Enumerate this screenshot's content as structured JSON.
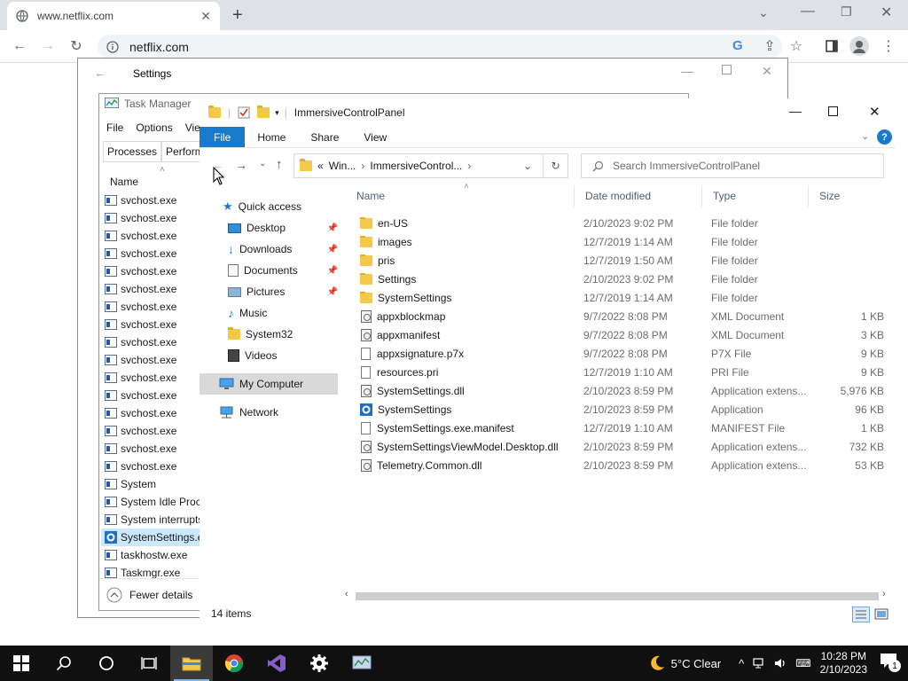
{
  "browser": {
    "tab_title": "www.netflix.com",
    "new_tab": "+",
    "url": "netflix.com"
  },
  "settings": {
    "title": "Settings"
  },
  "taskmgr": {
    "title": "Task Manager",
    "menu": [
      "File",
      "Options",
      "View"
    ],
    "tabs": [
      "Processes",
      "Performance"
    ],
    "col_name": "Name",
    "rows": [
      "svchost.exe",
      "svchost.exe",
      "svchost.exe",
      "svchost.exe",
      "svchost.exe",
      "svchost.exe",
      "svchost.exe",
      "svchost.exe",
      "svchost.exe",
      "svchost.exe",
      "svchost.exe",
      "svchost.exe",
      "svchost.exe",
      "svchost.exe",
      "svchost.exe",
      "svchost.exe",
      "System",
      "System Idle Process",
      "System interrupts",
      "SystemSettings.exe",
      "taskhostw.exe",
      "Taskmgr.exe"
    ],
    "fewer_details": "Fewer details"
  },
  "explorer": {
    "title": "ImmersiveControlPanel",
    "ribbon": {
      "file": "File",
      "home": "Home",
      "share": "Share",
      "view": "View"
    },
    "address": {
      "prefix": "«",
      "crumb1": "Win...",
      "crumb2": "ImmersiveControl..."
    },
    "search_placeholder": "Search ImmersiveControlPanel",
    "nav": {
      "quick_access": "Quick access",
      "desktop": "Desktop",
      "downloads": "Downloads",
      "documents": "Documents",
      "pictures": "Pictures",
      "music": "Music",
      "system32": "System32",
      "videos": "Videos",
      "my_computer": "My Computer",
      "network": "Network"
    },
    "columns": {
      "name": "Name",
      "date": "Date modified",
      "type": "Type",
      "size": "Size"
    },
    "files": [
      {
        "name": "en-US",
        "date": "2/10/2023 9:02 PM",
        "type": "File folder",
        "size": "",
        "icon": "folder"
      },
      {
        "name": "images",
        "date": "12/7/2019 1:14 AM",
        "type": "File folder",
        "size": "",
        "icon": "folder"
      },
      {
        "name": "pris",
        "date": "12/7/2019 1:50 AM",
        "type": "File folder",
        "size": "",
        "icon": "folder"
      },
      {
        "name": "Settings",
        "date": "2/10/2023 9:02 PM",
        "type": "File folder",
        "size": "",
        "icon": "folder"
      },
      {
        "name": "SystemSettings",
        "date": "12/7/2019 1:14 AM",
        "type": "File folder",
        "size": "",
        "icon": "folder"
      },
      {
        "name": "appxblockmap",
        "date": "9/7/2022 8:08 PM",
        "type": "XML Document",
        "size": "1 KB",
        "icon": "xml"
      },
      {
        "name": "appxmanifest",
        "date": "9/7/2022 8:08 PM",
        "type": "XML Document",
        "size": "3 KB",
        "icon": "xml"
      },
      {
        "name": "appxsignature.p7x",
        "date": "9/7/2022 8:08 PM",
        "type": "P7X File",
        "size": "9 KB",
        "icon": "file"
      },
      {
        "name": "resources.pri",
        "date": "12/7/2019 1:10 AM",
        "type": "PRI File",
        "size": "9 KB",
        "icon": "file"
      },
      {
        "name": "SystemSettings.dll",
        "date": "2/10/2023 8:59 PM",
        "type": "Application extens...",
        "size": "5,976 KB",
        "icon": "dll"
      },
      {
        "name": "SystemSettings",
        "date": "2/10/2023 8:59 PM",
        "type": "Application",
        "size": "96 KB",
        "icon": "gear"
      },
      {
        "name": "SystemSettings.exe.manifest",
        "date": "12/7/2019 1:10 AM",
        "type": "MANIFEST File",
        "size": "1 KB",
        "icon": "file"
      },
      {
        "name": "SystemSettingsViewModel.Desktop.dll",
        "date": "2/10/2023 8:59 PM",
        "type": "Application extens...",
        "size": "732 KB",
        "icon": "dll"
      },
      {
        "name": "Telemetry.Common.dll",
        "date": "2/10/2023 8:59 PM",
        "type": "Application extens...",
        "size": "53 KB",
        "icon": "dll"
      }
    ],
    "status": "14 items"
  },
  "taskbar": {
    "weather": "5°C  Clear",
    "time": "10:28 PM",
    "date": "2/10/2023",
    "notif_count": "1"
  },
  "colors": {
    "accent": "#1979ca",
    "taskbar": "#101010",
    "selection": "#cce8ff"
  }
}
